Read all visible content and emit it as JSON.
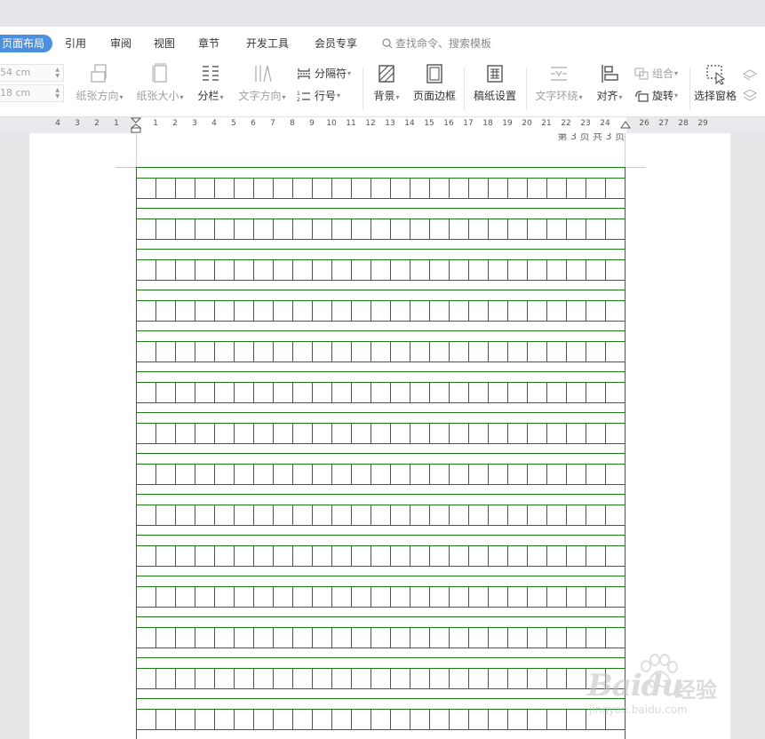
{
  "tabs": [
    {
      "label": "页面布局",
      "active": true
    },
    {
      "label": "引用"
    },
    {
      "label": "审阅"
    },
    {
      "label": "视图"
    },
    {
      "label": "章节"
    },
    {
      "label": "开发工具"
    },
    {
      "label": "会员专享"
    }
  ],
  "search": {
    "label": "查找命令、搜索模板"
  },
  "ribbon": {
    "margin_top_value": "54 cm",
    "margin_bottom_value": "18 cm",
    "orientation": "纸张方向",
    "size": "纸张大小",
    "columns": "分栏",
    "text_direction": "文字方向",
    "separator": "分隔符",
    "line_number": "行号",
    "background": "背景",
    "page_border": "页面边框",
    "manuscript": "稿纸设置",
    "text_wrap": "文字环绕",
    "align": "对齐",
    "group": "组合",
    "rotate": "旋转",
    "selection_pane": "选择窗格"
  },
  "ruler": {
    "left_numbers": [
      "4",
      "3",
      "2",
      "1"
    ],
    "right_numbers": [
      "1",
      "2",
      "3",
      "4",
      "5",
      "6",
      "7",
      "8",
      "9",
      "10",
      "11",
      "12",
      "13",
      "14",
      "15",
      "16",
      "17",
      "18",
      "19",
      "20",
      "21",
      "22",
      "23",
      "24",
      "26",
      "27",
      "28",
      "29"
    ]
  },
  "document": {
    "page_header": "第 3 页 共 3 页",
    "grid_columns": 25,
    "grid_color": "#1a7a1a"
  },
  "watermark": {
    "brand": "Baidu",
    "suffix": "经验",
    "url": "jingyan.baidu.com"
  }
}
